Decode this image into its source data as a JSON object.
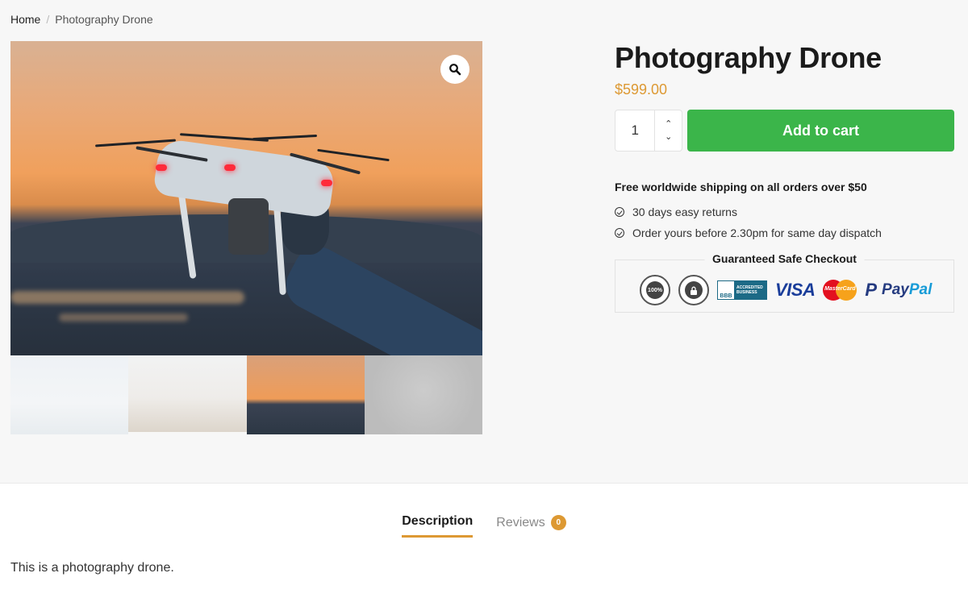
{
  "breadcrumb": {
    "home": "Home",
    "separator": "/",
    "current": "Photography Drone"
  },
  "product": {
    "title": "Photography Drone",
    "price": "$599.00",
    "quantity": "1",
    "add_to_cart_label": "Add to cart",
    "shipping_note": "Free worldwide shipping on all orders over $50",
    "perks": [
      "30 days easy returns",
      "Order yours before 2.30pm for same day dispatch"
    ],
    "safe_checkout_title": "Guaranteed Safe Checkout",
    "badges": {
      "satisfaction": "100%",
      "secure": "secure-ordering-lock",
      "bbb_left": "BBB",
      "bbb_right": "ACCREDITED BUSINESS",
      "visa": "VISA",
      "mastercard": "MasterCard",
      "paypal_pay": "Pay",
      "paypal_pal": "Pal"
    }
  },
  "gallery": {
    "main_image_alt": "Drone held in hand at sunset",
    "zoom_icon": "magnifier-icon",
    "thumbnails": [
      "drone-white-sky",
      "couple-sitting",
      "drone-sunset",
      "drone-gray-clouds"
    ],
    "active_thumbnail": 2
  },
  "tabs": [
    {
      "label": "Description",
      "active": true
    },
    {
      "label": "Reviews",
      "active": false,
      "count": "0"
    }
  ],
  "description": "This is a photography drone.",
  "colors": {
    "accent": "#dd9933",
    "cart_button": "#3bb54a"
  }
}
